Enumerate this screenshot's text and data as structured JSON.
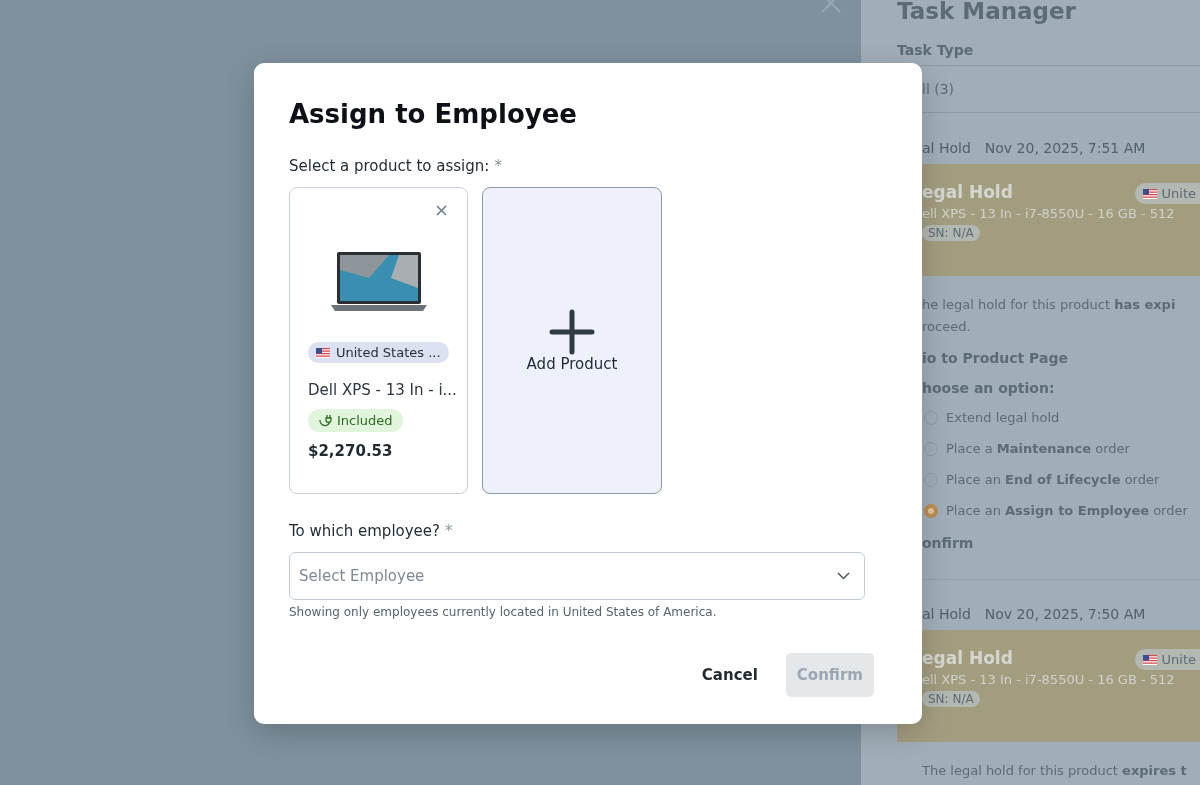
{
  "task_panel": {
    "title": "Task Manager",
    "filter_label": "Task Type",
    "filter_value": "ll (3)",
    "tasks": [
      {
        "type": "al Hold",
        "date": "Nov 20, 2025, 7:51 AM",
        "card": {
          "title": "egal Hold",
          "country": "Unite",
          "product": "ell XPS - 13 In - i7-8550U - 16 GB - 512",
          "serial": "SN: N/A"
        },
        "description": [
          "he legal hold for this product **has expi**",
          "roceed."
        ],
        "link": "io to Product Page",
        "options_label": "hoose an option:",
        "options": [
          {
            "label": "Extend legal hold",
            "selected": false
          },
          {
            "label": "Place a **Maintenance** order",
            "selected": false
          },
          {
            "label": "Place an **End of Lifecycle** order",
            "selected": false
          },
          {
            "label": "Place an **Assign to Employee** order",
            "selected": true
          }
        ],
        "action": "onfirm"
      },
      {
        "type": "al Hold",
        "date": "Nov 20, 2025, 7:50 AM",
        "card": {
          "title": "egal Hold",
          "country": "Unite",
          "product": "ell XPS - 13 In - i7-8550U - 16 GB - 512",
          "serial": "SN: N/A"
        },
        "description": [
          "The legal hold for this product **expires t**"
        ]
      }
    ]
  },
  "dialog": {
    "title": "Assign to Employee",
    "product_label": "Select a product to assign:",
    "product_required": "*",
    "products": [
      {
        "kind": "product",
        "country": "United States ...",
        "name": "Dell XPS - 13 In - i...",
        "status": "Included",
        "price": "$2,270.53"
      },
      {
        "kind": "add",
        "label": "Add Product"
      }
    ],
    "employee_label": "To which employee?",
    "employee_required": "*",
    "employee_placeholder": "Select Employee",
    "employee_hint": "Showing only employees currently located in United States of America.",
    "buttons": [
      {
        "label": "Cancel",
        "disabled": false
      },
      {
        "label": "Confirm",
        "disabled": true
      }
    ]
  }
}
